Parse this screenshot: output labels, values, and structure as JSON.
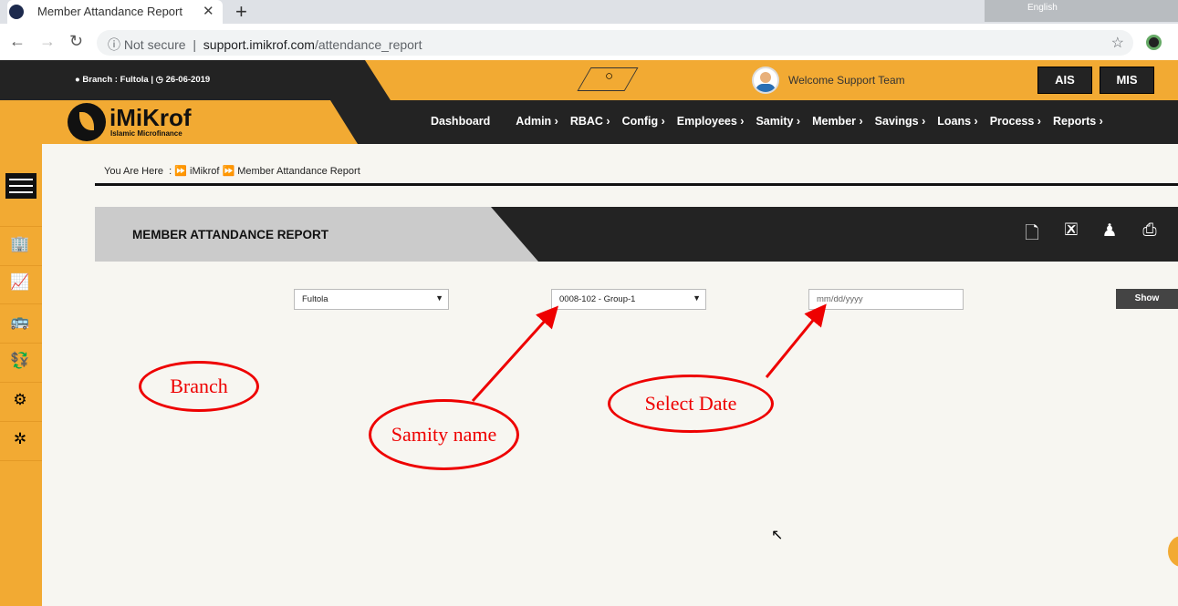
{
  "browser": {
    "tab_title": "Member Attandance Report",
    "security": "Not secure",
    "url_host": "support.imikrof.com",
    "url_path": "/attendance_report",
    "tray_language": "English"
  },
  "header": {
    "branch_info": "Branch : Fultola |",
    "date": "26-06-2019",
    "welcome": "Welcome Support Team",
    "buttons": [
      "AIS",
      "MIS"
    ],
    "brand": "iMiKrof",
    "brand_sub": "Islamic Microfinance"
  },
  "menu": [
    "Dashboard",
    "Admin ›",
    "RBAC ›",
    "Config ›",
    "Employees ›",
    "Samity ›",
    "Member ›",
    "Savings ›",
    "Loans ›",
    "Process ›",
    "Reports ›"
  ],
  "sidebar": {
    "icons": [
      "building-icon",
      "chart-icon",
      "bus-icon",
      "hand-money-icon",
      "gears-icon",
      "network-icon"
    ]
  },
  "breadcrumb": {
    "label": "You Are Here",
    "sep": ":",
    "items": [
      "iMikrof",
      "Member Attandance Report"
    ]
  },
  "report": {
    "title": "MEMBER ATTANDANCE REPORT",
    "actions": [
      "pdf-icon",
      "excel-icon",
      "user-icon",
      "print-icon"
    ]
  },
  "form": {
    "branch": "Fultola",
    "samity": "0008-102 - Group-1",
    "date_placeholder": "mm/dd/yyyy",
    "show": "Show"
  },
  "annotations": {
    "branch": "Branch",
    "samity": "Samity name",
    "date": "Select Date",
    "color": "#e00000"
  },
  "colors": {
    "orange": "#f2aa33",
    "dark": "#232323"
  }
}
